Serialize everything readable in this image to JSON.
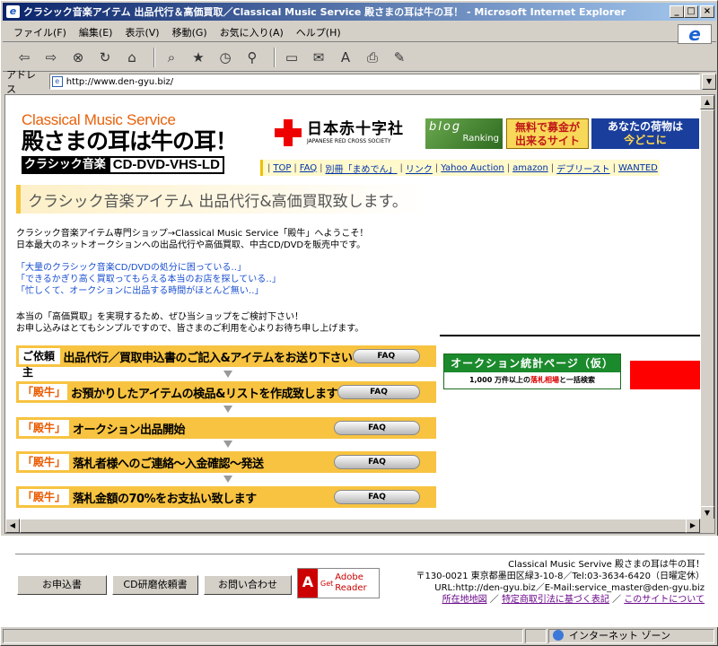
{
  "window": {
    "title": "クラシック音楽アイテム 出品代行＆高価買取／Classical Music Service 殿さまの耳は牛の耳！ - Microsoft Internet Explorer",
    "min_label": "_",
    "max_label": "□",
    "close_label": "×"
  },
  "menu": {
    "items": [
      "ファイル(F)",
      "編集(E)",
      "表示(V)",
      "移動(G)",
      "お気に入り(A)",
      "ヘルプ(H)"
    ]
  },
  "address": {
    "label": "アドレス",
    "url": "http://www.den-gyu.biz/"
  },
  "logo": {
    "line1": "Classical Music Service",
    "line2": "殿さまの耳は牛の耳！",
    "line3a": "クラシック音楽",
    "line3b": "CD-DVD-VHS-LD"
  },
  "banners": {
    "redcross_title": "日本赤十字社",
    "redcross_sub": "JAPANESE RED CROSS SOCIETY",
    "blog_top": "blog",
    "blog_bottom": "Ranking",
    "bokin_1": "無料で募金が",
    "bokin_2": "出来るサイト",
    "nimotsu_1": "あなたの荷物は",
    "nimotsu_2": "今どこに"
  },
  "nav": {
    "links": [
      "TOP",
      "FAQ",
      "別冊「まめでん」",
      "リンク",
      "Yahoo Auction",
      "amazon",
      "デブリースト",
      "WANTED"
    ]
  },
  "headline": "クラシック音楽アイテム 出品代行&高価買取致します。",
  "intro": {
    "line1": "クラシック音楽アイテム専門ショップ→Classical Music Service「殿牛」へようこそ！",
    "line2": "日本最大のネットオークションへの出品代行や高価買取、中古CD/DVDを販売中です。"
  },
  "quotes": [
    "「大量のクラシック音楽CD/DVDの処分に困っている‥」",
    "「できるかぎり高く買取ってもらえる本当のお店を探している‥」",
    "「忙しくて、オークションに出品する時間がほとんど無い‥」"
  ],
  "invite": {
    "line1": "本当の「高価買取」を実現するため、ぜひ当ショップをご検討下さい！",
    "line2": "お申し込みはとてもシンプルですので、皆さまのご利用を心よりお待ち申し上げます。"
  },
  "steps": [
    {
      "tag": "ご依頼主",
      "text": "出品代行／買取申込書のご記入&アイテムをお送り下さい",
      "faq": "FAQ"
    },
    {
      "tag": "「殿牛」",
      "text": "お預かりしたアイテムの検品&リストを作成致します",
      "faq": "FAQ"
    },
    {
      "tag": "「殿牛」",
      "text": "オークション出品開始",
      "faq": "FAQ"
    },
    {
      "tag": "「殿牛」",
      "text": "落札者様へのご連絡～入金確認～発送",
      "faq": "FAQ"
    },
    {
      "tag": "「殿牛」",
      "text": "落札金額の70%をお支払い致します",
      "faq": "FAQ"
    }
  ],
  "auction": {
    "title": "オークション統計ページ（仮）",
    "sub_a": "1,000 万件以上の",
    "sub_b": "落札相場",
    "sub_c": "と一括検索"
  },
  "footer": {
    "btn_apply": "お申込書",
    "btn_cd": "CD研磨依頼書",
    "btn_contact": "お問い合わせ",
    "adobe_get": "Get",
    "adobe_name1": "Adobe",
    "adobe_name2": "Reader",
    "adobe_brand": "Adobe",
    "shop": "Classical Music Servive 殿さまの耳は牛の耳！",
    "addr": "〒130-0021 東京都墨田区緑3-10-8／Tel:03-3634-6420（日曜定休）",
    "url": "URL:http://den-gyu.biz／E-Mail:service_master@den-gyu.biz",
    "link_map": "所在地地図",
    "link_law": "特定商取引法に基づく表記",
    "link_about": "このサイトについて"
  },
  "status": {
    "zone": "インターネット ゾーン"
  }
}
